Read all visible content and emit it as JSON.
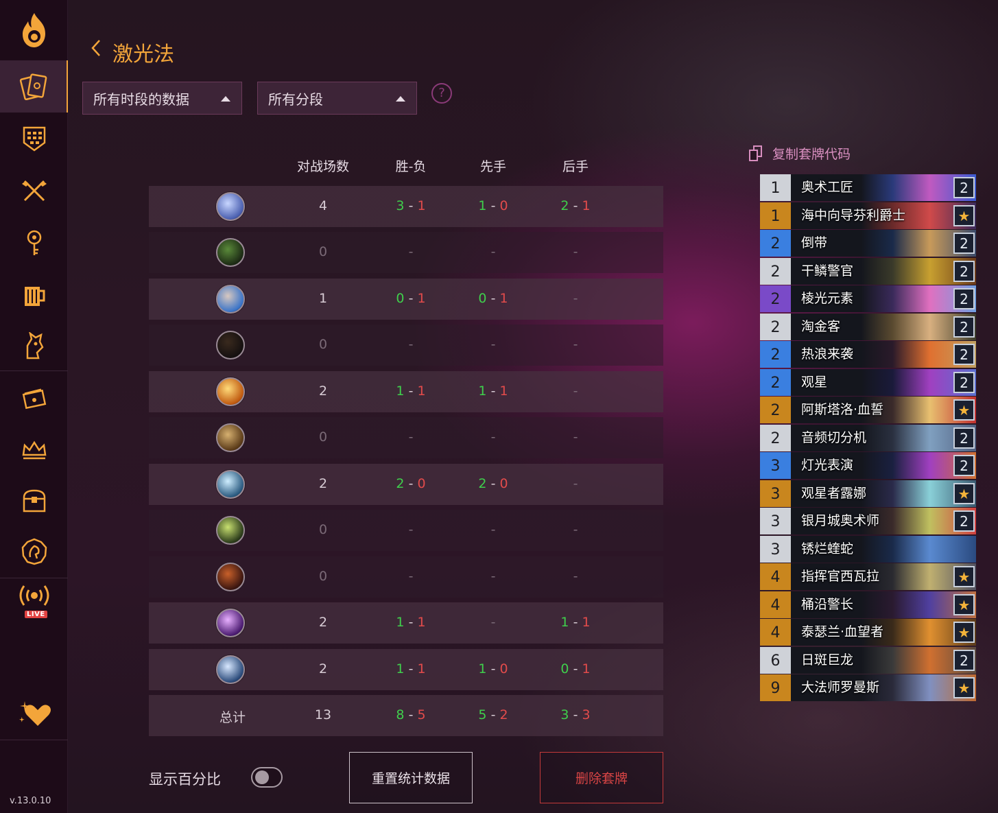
{
  "app": {
    "version": "v.13.0.10",
    "live_label": "LIVE",
    "accent_color": "#f3a53a"
  },
  "sidebar": {
    "items": [
      {
        "icon": "flame-logo-icon",
        "active": false
      },
      {
        "icon": "decks-icon",
        "active": true
      },
      {
        "icon": "stats-grid-icon",
        "active": false
      },
      {
        "icon": "crossed-axes-icon",
        "active": false
      },
      {
        "icon": "tavern-key-icon",
        "active": false
      },
      {
        "icon": "tankard-icon",
        "active": false
      },
      {
        "icon": "battlegrounds-icon",
        "active": false
      },
      {
        "icon": "card-packs-icon",
        "active": false
      },
      {
        "icon": "crown-icon",
        "active": false
      },
      {
        "icon": "treasure-chest-icon",
        "active": false
      },
      {
        "icon": "hero-portrait-icon",
        "active": false
      },
      {
        "icon": "live-broadcast-icon",
        "active": false
      },
      {
        "icon": "heart-sparkle-icon",
        "active": false
      }
    ]
  },
  "header": {
    "title": "激光法",
    "back_icon": "chevron-left-icon"
  },
  "filters": {
    "time_range": "所有时段的数据",
    "rank_range": "所有分段",
    "help": "?"
  },
  "table": {
    "columns": [
      "对战场数",
      "胜-负",
      "先手",
      "后手"
    ],
    "rows": [
      {
        "class_icon": "mage-class-icon",
        "games": "4",
        "wins": "3",
        "losses": "1",
        "first": {
          "w": "1",
          "l": "0"
        },
        "second": {
          "w": "2",
          "l": "1"
        }
      },
      {
        "class_icon": "rogue-class-icon",
        "games": "0",
        "wl_dash": "-",
        "first_dash": "-",
        "second_dash": "-"
      },
      {
        "class_icon": "shaman-class-icon",
        "games": "1",
        "wins": "0",
        "losses": "1",
        "first": {
          "w": "0",
          "l": "1"
        },
        "second_dash": "-"
      },
      {
        "class_icon": "hunter-class-icon",
        "games": "0",
        "wl_dash": "-",
        "first_dash": "-",
        "second_dash": "-"
      },
      {
        "class_icon": "paladin-class-icon",
        "games": "2",
        "wins": "1",
        "losses": "1",
        "first": {
          "w": "1",
          "l": "1"
        },
        "second_dash": "-"
      },
      {
        "class_icon": "druid-class-icon",
        "games": "0",
        "wl_dash": "-",
        "first_dash": "-",
        "second_dash": "-"
      },
      {
        "class_icon": "priest-class-icon",
        "games": "2",
        "wins": "2",
        "losses": "0",
        "first": {
          "w": "2",
          "l": "0"
        },
        "second_dash": "-"
      },
      {
        "class_icon": "demon-hunter-class-icon",
        "games": "0",
        "wl_dash": "-",
        "first_dash": "-",
        "second_dash": "-"
      },
      {
        "class_icon": "warlock-class-icon",
        "games": "0",
        "wl_dash": "-",
        "first_dash": "-",
        "second_dash": "-"
      },
      {
        "class_icon": "death-knight-class-icon",
        "games": "2",
        "wins": "1",
        "losses": "1",
        "first_dash": "-",
        "second": {
          "w": "1",
          "l": "1"
        }
      },
      {
        "class_icon": "warrior-class-icon",
        "games": "2",
        "wins": "1",
        "losses": "1",
        "first": {
          "w": "1",
          "l": "0"
        },
        "second": {
          "w": "0",
          "l": "1"
        }
      }
    ],
    "total": {
      "label": "总计",
      "games": "13",
      "wins": "8",
      "losses": "5",
      "first": {
        "w": "5",
        "l": "2"
      },
      "second": {
        "w": "3",
        "l": "3"
      }
    },
    "wl_sep": "-"
  },
  "controls": {
    "show_percent_label": "显示百分比",
    "show_percent_on": false,
    "reset_label": "重置统计数据",
    "delete_label": "删除套牌"
  },
  "deck": {
    "copy_code_label": "复制套牌代码",
    "cards": [
      {
        "cost": "1",
        "name": "奥术工匠",
        "count": "2",
        "rarity": "common"
      },
      {
        "cost": "1",
        "name": "海中向导芬利爵士",
        "count": "★",
        "rarity": "legendary"
      },
      {
        "cost": "2",
        "name": "倒带",
        "count": "2",
        "rarity": "rare"
      },
      {
        "cost": "2",
        "name": "干鳞警官",
        "count": "2",
        "rarity": "common"
      },
      {
        "cost": "2",
        "name": "棱光元素",
        "count": "2",
        "rarity": "epic"
      },
      {
        "cost": "2",
        "name": "淘金客",
        "count": "2",
        "rarity": "common"
      },
      {
        "cost": "2",
        "name": "热浪来袭",
        "count": "2",
        "rarity": "rare"
      },
      {
        "cost": "2",
        "name": "观星",
        "count": "2",
        "rarity": "rare"
      },
      {
        "cost": "2",
        "name": "阿斯塔洛·血誓",
        "count": "★",
        "rarity": "legendary"
      },
      {
        "cost": "2",
        "name": "音频切分机",
        "count": "2",
        "rarity": "common"
      },
      {
        "cost": "3",
        "name": "灯光表演",
        "count": "2",
        "rarity": "rare"
      },
      {
        "cost": "3",
        "name": "观星者露娜",
        "count": "★",
        "rarity": "legendary"
      },
      {
        "cost": "3",
        "name": "银月城奥术师",
        "count": "2",
        "rarity": "common"
      },
      {
        "cost": "3",
        "name": "锈烂蝰蛇",
        "count": "",
        "rarity": "common"
      },
      {
        "cost": "4",
        "name": "指挥官西瓦拉",
        "count": "★",
        "rarity": "legendary"
      },
      {
        "cost": "4",
        "name": "桶沿警长",
        "count": "★",
        "rarity": "legendary"
      },
      {
        "cost": "4",
        "name": "泰瑟兰·血望者",
        "count": "★",
        "rarity": "legendary"
      },
      {
        "cost": "6",
        "name": "日斑巨龙",
        "count": "2",
        "rarity": "common"
      },
      {
        "cost": "9",
        "name": "大法师罗曼斯",
        "count": "★",
        "rarity": "legendary"
      }
    ],
    "rarity_colors": {
      "common": "#cfd2d8",
      "rare": "#3a7fe0",
      "epic": "#7a4ac8",
      "legendary": "#c9861e"
    }
  }
}
